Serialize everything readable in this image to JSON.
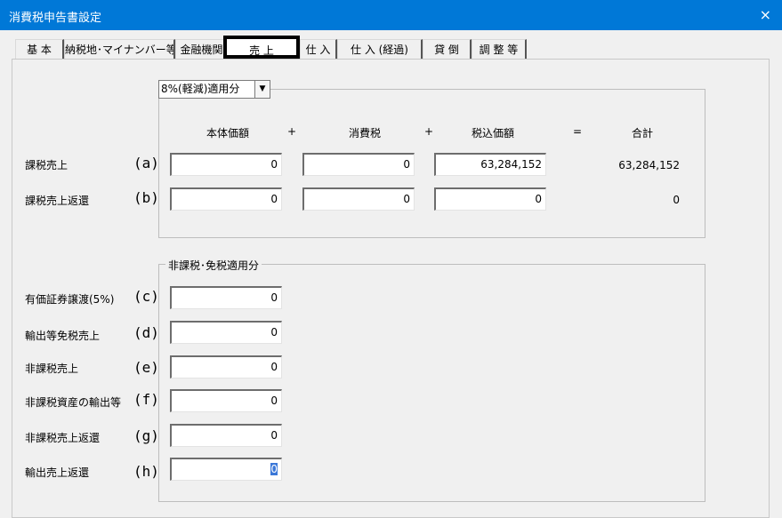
{
  "window": {
    "title": "消費税申告書設定",
    "close": "×"
  },
  "tabs": [
    {
      "label": "基 本"
    },
    {
      "label": "納税地･マイナンバー等"
    },
    {
      "label": "金融機関"
    },
    {
      "label": "売 上"
    },
    {
      "label": "仕 入"
    },
    {
      "label": "仕 入 (経過)"
    },
    {
      "label": "貸 倒"
    },
    {
      "label": "調 整 等"
    }
  ],
  "group1": {
    "combo_value": "8%(軽減)適用分",
    "combo_arrow": "▼",
    "headers": {
      "base": "本体価額",
      "plus1": "+",
      "tax": "消費税",
      "plus2": "+",
      "inclusive": "税込価額",
      "eq": "=",
      "total": "合計"
    },
    "rows": [
      {
        "label": "課税売上",
        "letter": "(a)",
        "base": "0",
        "tax": "0",
        "inclusive": "63,284,152",
        "total": "63,284,152"
      },
      {
        "label": "課税売上返還",
        "letter": "(b)",
        "base": "0",
        "tax": "0",
        "inclusive": "0",
        "total": "0"
      }
    ]
  },
  "group2": {
    "legend": "非課税･免税適用分",
    "rows": [
      {
        "label": "有価証券譲渡(5%)",
        "letter": "(c)",
        "value": "0"
      },
      {
        "label": "輸出等免税売上",
        "letter": "(d)",
        "value": "0"
      },
      {
        "label": "非課税売上",
        "letter": "(e)",
        "value": "0"
      },
      {
        "label": "非課税資産の輸出等",
        "letter": "(f)",
        "value": "0"
      },
      {
        "label": "非課税売上返還",
        "letter": "(g)",
        "value": "0"
      },
      {
        "label": "輸出売上返還",
        "letter": "(h)",
        "value": "0"
      }
    ]
  }
}
